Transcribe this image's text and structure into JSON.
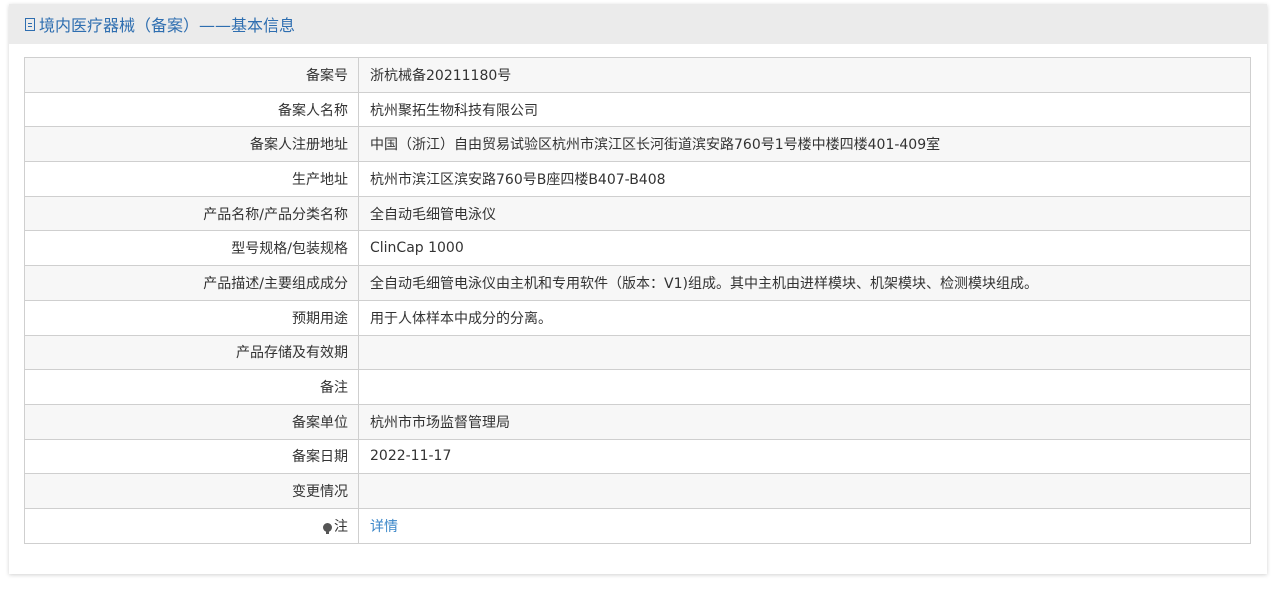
{
  "header": {
    "title": "境内医疗器械（备案）——基本信息",
    "icon": "document-icon",
    "color": "#2e6eb0"
  },
  "rows": [
    {
      "label": "备案号",
      "value": "浙杭械备20211180号"
    },
    {
      "label": "备案人名称",
      "value": "杭州聚拓生物科技有限公司"
    },
    {
      "label": "备案人注册地址",
      "value": "中国（浙江）自由贸易试验区杭州市滨江区长河街道滨安路760号1号楼中楼四楼401-409室"
    },
    {
      "label": "生产地址",
      "value": "杭州市滨江区滨安路760号B座四楼B407-B408"
    },
    {
      "label": "产品名称/产品分类名称",
      "value": "全自动毛细管电泳仪"
    },
    {
      "label": "型号规格/包装规格",
      "value": "ClinCap 1000"
    },
    {
      "label": "产品描述/主要组成成分",
      "value": "全自动毛细管电泳仪由主机和专用软件（版本：V1)组成。其中主机由进样模块、机架模块、检测模块组成。"
    },
    {
      "label": "预期用途",
      "value": "用于人体样本中成分的分离。"
    },
    {
      "label": "产品存储及有效期",
      "value": ""
    },
    {
      "label": "备注",
      "value": ""
    },
    {
      "label": "备案单位",
      "value": "杭州市市场监督管理局"
    },
    {
      "label": "备案日期",
      "value": "2022-11-17"
    },
    {
      "label": "变更情况",
      "value": ""
    }
  ],
  "note_row": {
    "label": "注",
    "icon": "lightbulb-icon",
    "link_text": "详情",
    "link_color": "#3a86c8"
  }
}
